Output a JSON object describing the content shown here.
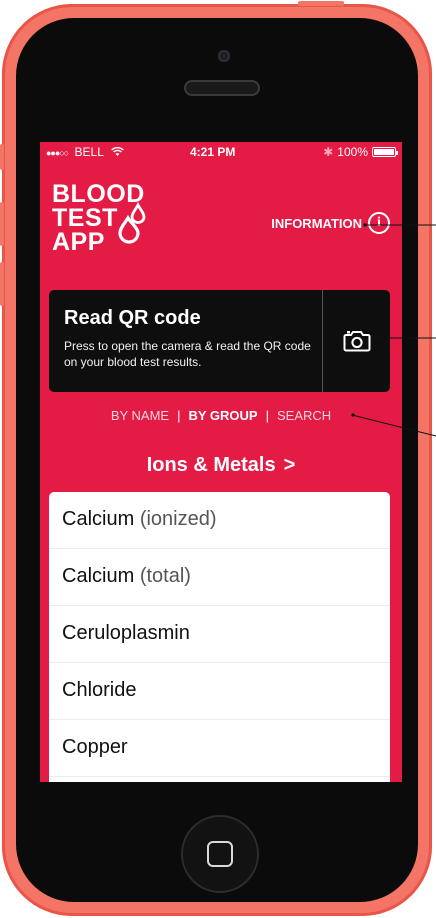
{
  "status_bar": {
    "signal": "●●●○○",
    "carrier": "BELL",
    "time": "4:21 PM",
    "bluetooth": "✱",
    "battery_percent": "100%",
    "battery_level": 1.0
  },
  "header": {
    "logo_lines": [
      "BLOOD",
      "TEST",
      "APP"
    ],
    "info_label": "INFORMATION",
    "info_icon": "info-circle-icon"
  },
  "qr": {
    "title": "Read QR code",
    "description": "Press to open the camera & read the QR code on your blood test results.",
    "icon": "camera-icon"
  },
  "tabs": {
    "by_name": "BY NAME",
    "by_group": "BY GROUP",
    "search": "SEARCH",
    "separator": "|",
    "active": "by_group"
  },
  "group": {
    "title": "Ions & Metals",
    "chevron": ">"
  },
  "list": [
    {
      "name": "Calcium",
      "qualifier": "(ionized)"
    },
    {
      "name": "Calcium",
      "qualifier": "(total)"
    },
    {
      "name": "Ceruloplasmin",
      "qualifier": ""
    },
    {
      "name": "Chloride",
      "qualifier": ""
    },
    {
      "name": "Copper",
      "qualifier": ""
    }
  ],
  "colors": {
    "brand_red": "#e41b45",
    "phone_shell": "#f47466",
    "card_black": "#0e0e0e"
  }
}
